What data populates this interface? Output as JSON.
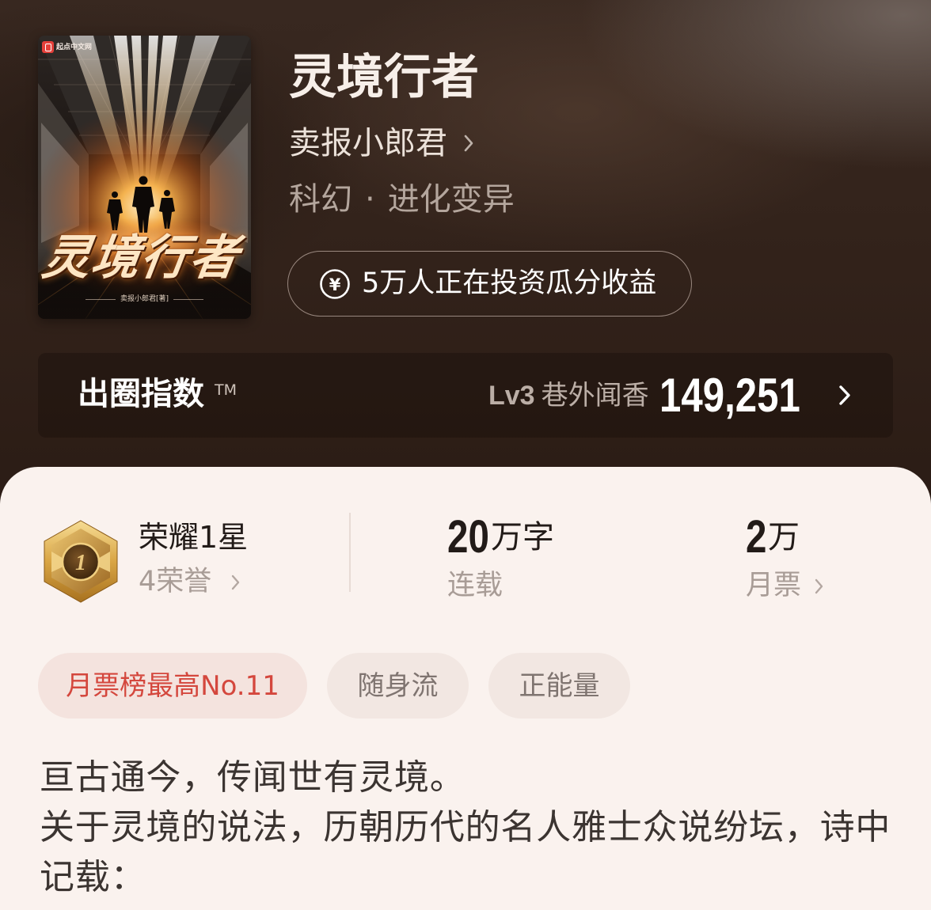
{
  "book": {
    "title": "灵境行者",
    "author": "卖报小郎君",
    "category": "科幻",
    "category_separator": "·",
    "subcategory": "进化变异"
  },
  "cover": {
    "publisher_logo": "起点中文网",
    "title_art": "灵境行者",
    "author_credit": "卖报小郎君[著]"
  },
  "invest": {
    "icon": "yuan-coin-icon",
    "icon_glyph": "¥",
    "label": "5万人正在投资瓜分收益"
  },
  "influence_index": {
    "label": "出圈指数",
    "trademark": "TM",
    "level": "Lv3",
    "level_name": "巷外闻香",
    "score": "149,251",
    "icon": "chevron-right-icon"
  },
  "stats": {
    "honor": {
      "medal_icon": "honor-medal-icon",
      "medal_digit": "1",
      "rank": "荣耀1星",
      "count": "4荣誉"
    },
    "word_count": {
      "value": "20",
      "unit": "万字",
      "status": "连载"
    },
    "monthly_tickets": {
      "value": "2",
      "unit": "万",
      "label": "月票"
    }
  },
  "tags": [
    {
      "label": "月票榜最高No.11",
      "highlighted": true
    },
    {
      "label": "随身流",
      "highlighted": false
    },
    {
      "label": "正能量",
      "highlighted": false
    }
  ],
  "description": {
    "lines": [
      "亘古通今，传闻世有灵境。",
      "关于灵境的说法，历朝历代的名人雅士众说纷坛，诗中",
      "记载："
    ]
  },
  "colors": {
    "header_background": "#33231b",
    "card_background": "#faf2ee",
    "tag_background": "#f2e7e2",
    "tag_highlight_background": "#f4e3de",
    "tag_highlight_text": "#d4473d",
    "tag_text": "#7f7470",
    "text_primary": "#221b18",
    "text_secondary": "#a89c96",
    "medal_gold": "#d7a544"
  }
}
